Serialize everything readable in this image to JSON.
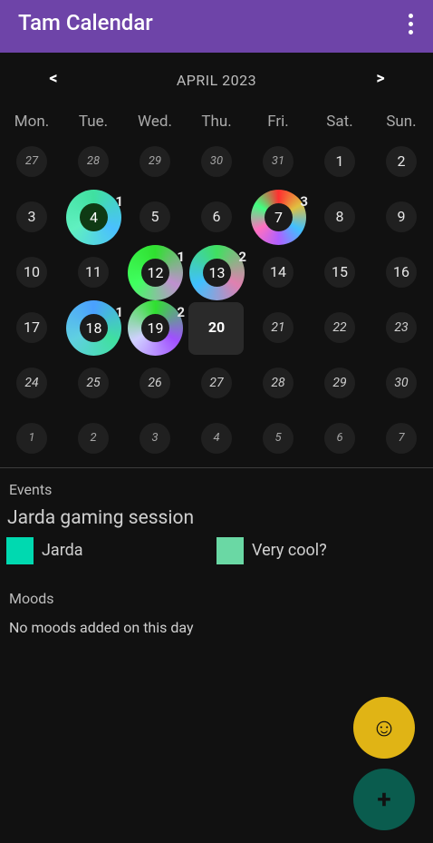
{
  "app": {
    "title": "Tam Calendar",
    "menu_icon": "more-vert-icon"
  },
  "calendar": {
    "prev_label": "<",
    "next_label": ">",
    "month_label": "APRIL 2023",
    "weekdays": [
      "Mon.",
      "Tue.",
      "Wed.",
      "Thu.",
      "Fri.",
      "Sat.",
      "Sun."
    ],
    "weeks": [
      [
        "27",
        "28",
        "29",
        "30",
        "31",
        "1",
        "2"
      ],
      [
        "3",
        "4",
        "5",
        "6",
        "7",
        "8",
        "9"
      ],
      [
        "10",
        "11",
        "12",
        "13",
        "14",
        "15",
        "16"
      ],
      [
        "17",
        "18",
        "19",
        "20",
        "21",
        "22",
        "23"
      ],
      [
        "24",
        "25",
        "26",
        "27",
        "28",
        "29",
        "30"
      ],
      [
        "1",
        "2",
        "3",
        "4",
        "5",
        "6",
        "7"
      ]
    ],
    "ring_days": {
      "4": {
        "count": "1",
        "colors": [
          "#40e0a0",
          "#4ac0ff",
          "#60f0c0"
        ]
      },
      "7": {
        "count": "3",
        "colors": [
          "#ff3030",
          "#e0c040",
          "#40c0ff",
          "#b060ff",
          "#ff70c0",
          "#40ff80"
        ]
      },
      "12": {
        "count": "1",
        "colors": [
          "#30e030",
          "#c090d0",
          "#40ff60"
        ]
      },
      "13": {
        "count": "2",
        "colors": [
          "#40e060",
          "#e080b0",
          "#40c0ff"
        ]
      },
      "18": {
        "count": "1",
        "colors": [
          "#4aa0ff",
          "#40e0a0",
          "#60d0e0"
        ]
      },
      "19": {
        "count": "2",
        "colors": [
          "#30e030",
          "#a050ff",
          "#d0d0ff"
        ]
      }
    },
    "today": "20"
  },
  "events": {
    "heading": "Events",
    "title": "Jarda gaming session",
    "tags": [
      {
        "label": "Jarda",
        "color": "#00d9b0"
      },
      {
        "label": "Very cool?",
        "color": "#6ad8a4"
      }
    ]
  },
  "moods": {
    "heading": "Moods",
    "empty_text": "No moods added on this day"
  },
  "fabs": {
    "mood_icon": "smiley-icon",
    "add_icon": "plus-icon",
    "mood_glyph": "☺",
    "add_glyph": "+"
  }
}
